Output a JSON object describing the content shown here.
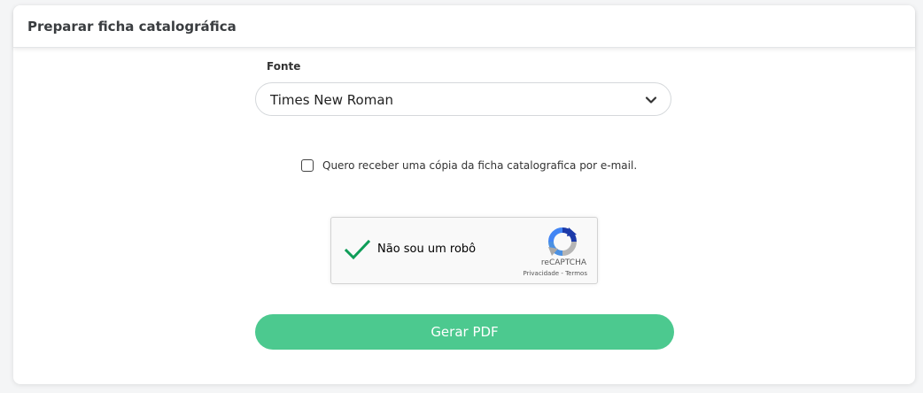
{
  "card": {
    "title": "Preparar ficha catalográfica"
  },
  "font_field": {
    "label": "Fonte",
    "selected": "Times New Roman",
    "icon": "chevron-down-icon"
  },
  "email_copy": {
    "checked": false,
    "label": "Quero receber uma cópia da ficha catalografica por e-mail."
  },
  "recaptcha": {
    "checked": true,
    "label": "Não sou um robô",
    "brand": "reCAPTCHA",
    "privacy": "Privacidade",
    "separator": " - ",
    "terms": "Termos",
    "check_color": "#0f9d58"
  },
  "submit": {
    "label": "Gerar PDF",
    "color": "#4cc98f"
  }
}
